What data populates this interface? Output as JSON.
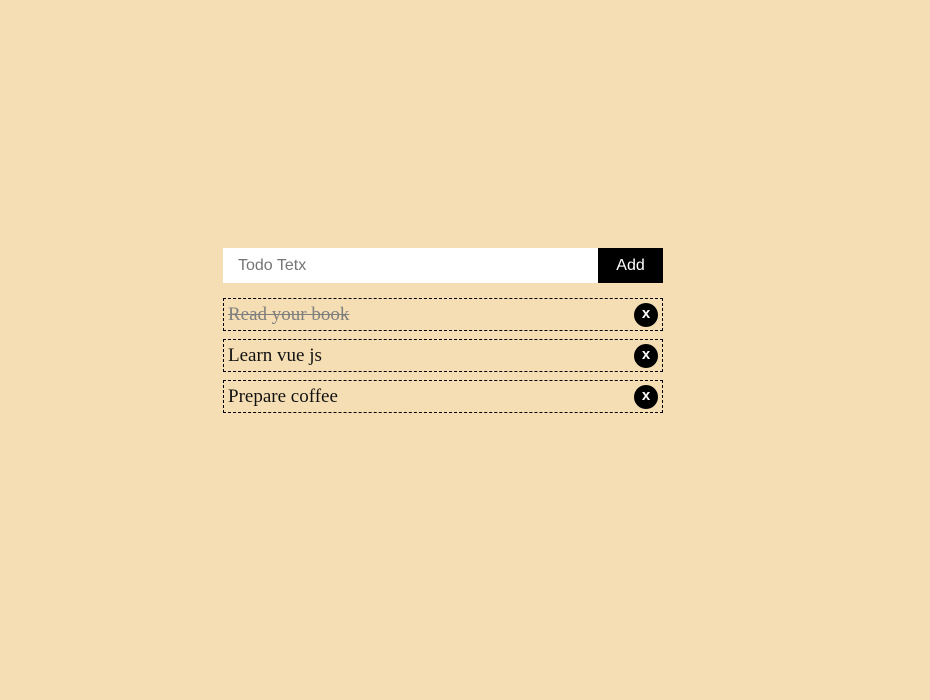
{
  "form": {
    "input_placeholder": "Todo Tetx",
    "input_value": "",
    "add_label": "Add"
  },
  "todos": [
    {
      "text": "Read your book",
      "done": true,
      "delete_label": "x"
    },
    {
      "text": "Learn vue js",
      "done": false,
      "delete_label": "x"
    },
    {
      "text": "Prepare coffee",
      "done": false,
      "delete_label": "x"
    }
  ],
  "colors": {
    "background": "#f5deb3",
    "button": "#000000",
    "done_text": "#7f7f7f"
  }
}
